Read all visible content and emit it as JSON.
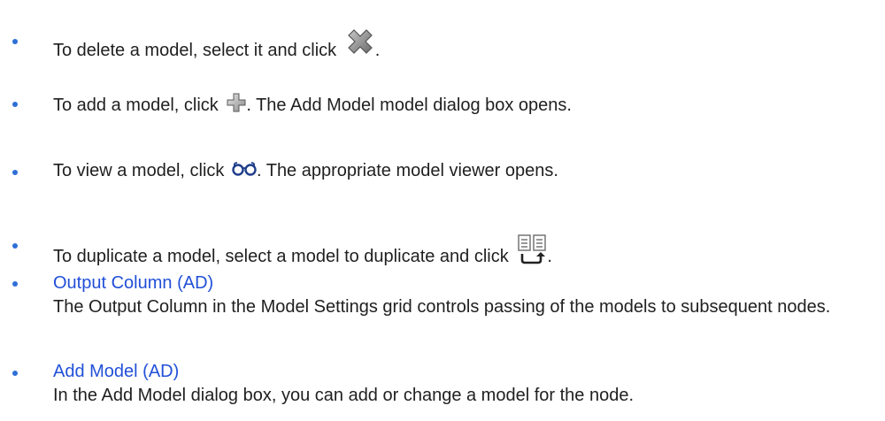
{
  "bullets": [
    {
      "before": "To delete a model, select it and click",
      "icon": "delete-x-icon",
      "after": "."
    },
    {
      "before": "To add a model, click",
      "icon": "add-plus-icon",
      "after": ". The Add Model model dialog box opens."
    },
    {
      "before": "To view a model, click",
      "icon": "view-glasses-icon",
      "after": ". The appropriate model viewer opens."
    },
    {
      "before": "To duplicate a model, select a model to duplicate and click",
      "icon": "duplicate-icon",
      "after": "."
    }
  ],
  "links": [
    {
      "title": "Output Column (AD)",
      "description": "The Output Column in the Model Settings grid controls passing of the models to subsequent nodes."
    },
    {
      "title": "Add Model (AD)",
      "description": "In the Add Model dialog box, you can add or change a model for the node."
    }
  ],
  "colors": {
    "bullet": "#2e6fd6",
    "link": "#2150d8",
    "text": "#1f1f1f"
  }
}
